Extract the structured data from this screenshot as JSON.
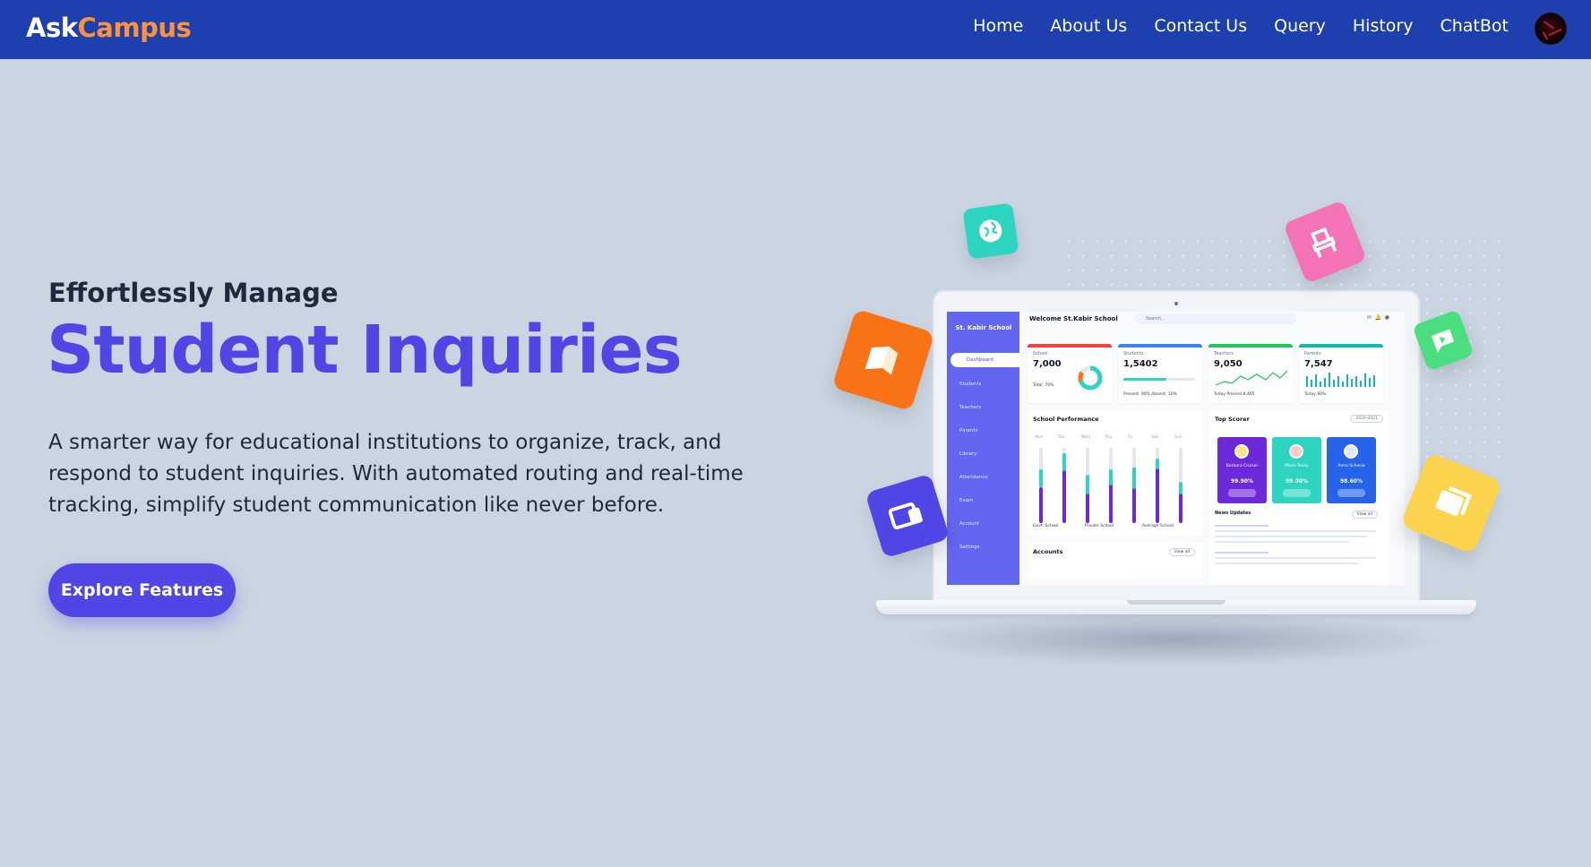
{
  "brand": {
    "part1": "Ask",
    "part2": "Campus"
  },
  "nav": {
    "items": [
      "Home",
      "About Us",
      "Contact Us",
      "Query",
      "History",
      "ChatBot"
    ]
  },
  "hero": {
    "kicker": "Effortlessly Manage",
    "headline": "Student Inquiries",
    "description": "A smarter way for educational institutions to organize, track, and respond to student inquiries. With automated routing and real-time tracking, simplify student communication like never before.",
    "cta": "Explore Features"
  },
  "illustration": {
    "sidebar": {
      "school": "St. Kabir School",
      "items": [
        "Dashboard",
        "Students",
        "Teachers",
        "Parents",
        "Library",
        "Attendance",
        "Exam",
        "Account",
        "Settings"
      ]
    },
    "welcome": "Welcome St.Kabir School",
    "search_placeholder": "Search...",
    "cards": [
      {
        "label": "School",
        "value": "7,000",
        "sub": "Total: 70%",
        "color": "#ef4444"
      },
      {
        "label": "Students",
        "value": "1,5402",
        "sub": "Present: 90%    Absent: 10%",
        "color": "#3b82f6"
      },
      {
        "label": "Teachers",
        "value": "9,050",
        "sub": "Today Present 8,465",
        "color": "#22c55e"
      },
      {
        "label": "Parents",
        "value": "7,547",
        "sub": "Today 60%",
        "color": "#14b8a6"
      }
    ],
    "performance": {
      "title": "School Performance",
      "days": [
        "Mon",
        "Tue",
        "Wed",
        "Thu",
        "Fri",
        "Sat",
        "Sun"
      ],
      "legend": [
        "Govt. School",
        "Private School",
        "Average School"
      ]
    },
    "top_scorer": {
      "title": "Top Scorer",
      "year": "2020-2021",
      "students": [
        {
          "name": "Barbara Cruiser",
          "score": "99.90%",
          "color": "#6d28d9"
        },
        {
          "name": "Marlo Tesey",
          "score": "99.00%",
          "color": "#2dd4bf"
        },
        {
          "name": "Anna Schesia",
          "score": "98.60%",
          "color": "#2563eb"
        }
      ],
      "news": "News Updates",
      "view_all": "View all"
    },
    "accounts": {
      "title": "Accounts",
      "view_all": "View all"
    },
    "tiles": {
      "globe": "globe-icon",
      "chair": "chair-icon",
      "book": "book-icon",
      "chat": "chat-icon",
      "devices": "devices-icon",
      "cards": "cards-icon"
    }
  }
}
